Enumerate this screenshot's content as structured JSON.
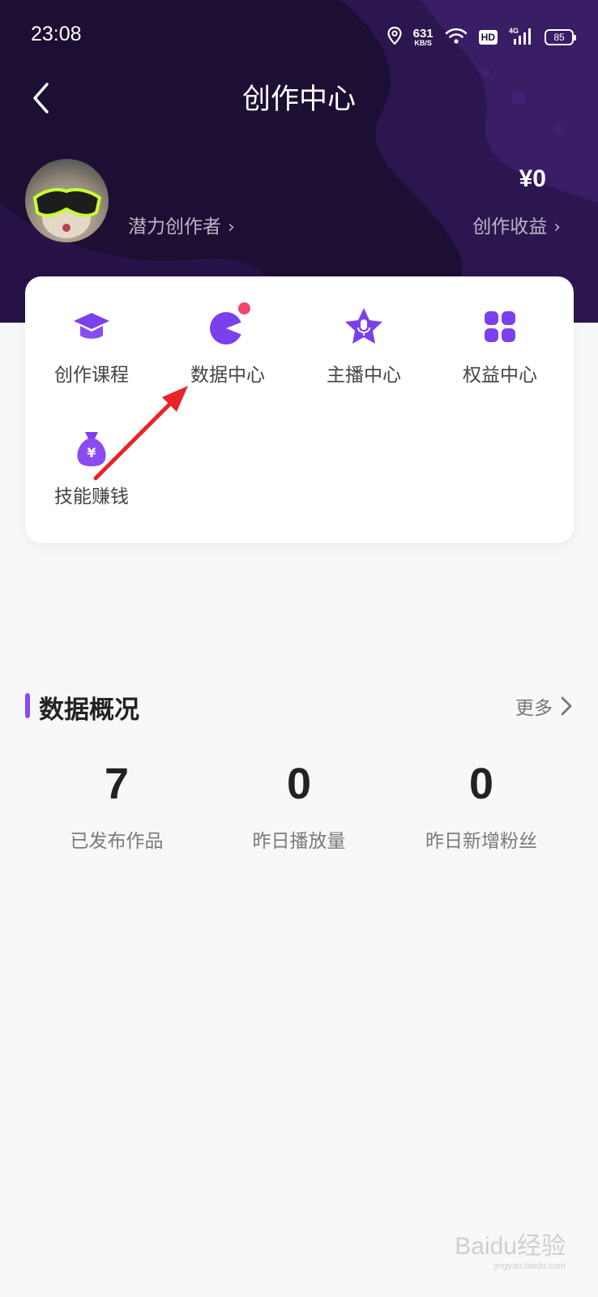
{
  "status_bar": {
    "time": "23:08",
    "speed_value": "631",
    "speed_unit": "KB/S",
    "hd_label": "HD",
    "network": "4G",
    "battery": "85"
  },
  "nav": {
    "title": "创作中心"
  },
  "profile": {
    "creator_level": "潜力创作者",
    "earnings_amount": "¥0",
    "earnings_label": "创作收益"
  },
  "tools": [
    {
      "label": "创作课程",
      "icon": "graduation-cap-icon"
    },
    {
      "label": "数据中心",
      "icon": "pie-chart-icon",
      "has_dot": true
    },
    {
      "label": "主播中心",
      "icon": "star-mic-icon"
    },
    {
      "label": "权益中心",
      "icon": "grid-icon"
    },
    {
      "label": "技能赚钱",
      "icon": "money-bag-icon"
    }
  ],
  "overview": {
    "title": "数据概况",
    "more_label": "更多",
    "stats": [
      {
        "value": "7",
        "label": "已发布作品"
      },
      {
        "value": "0",
        "label": "昨日播放量"
      },
      {
        "value": "0",
        "label": "昨日新增粉丝"
      }
    ]
  },
  "watermark": {
    "text": "Baidu经验",
    "sub": "jingyan.baidu.com"
  },
  "colors": {
    "header_bg": "#1c0f33",
    "accent": "#8a4cf2",
    "dot": "#f1456b",
    "arrow": "#e8232a"
  }
}
